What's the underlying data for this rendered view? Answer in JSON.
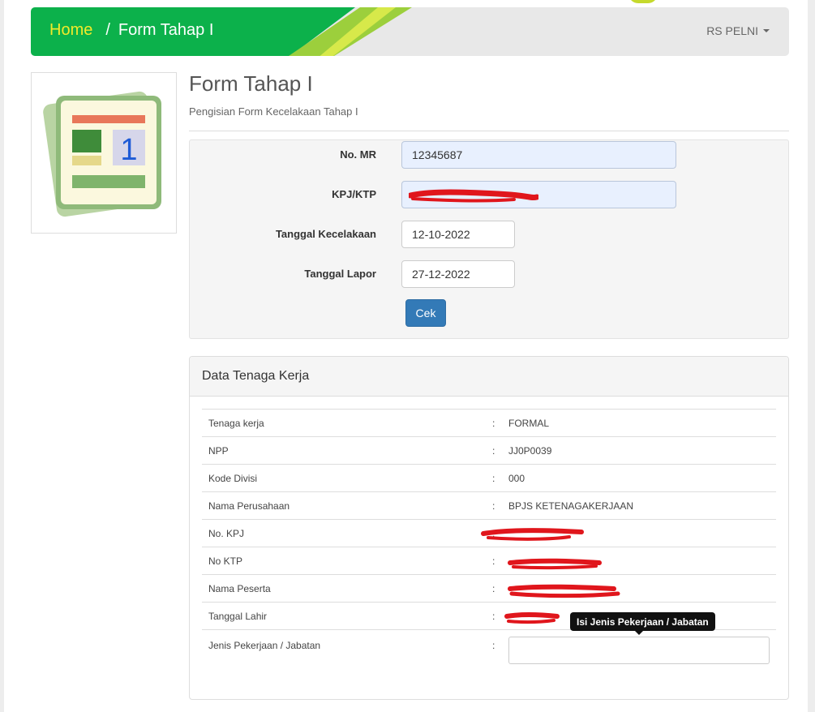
{
  "navbar": {
    "home_label": "Home",
    "separator": "/",
    "current_label": "Form Tahap I",
    "user_label": "RS PELNI"
  },
  "header": {
    "title": "Form Tahap I",
    "subtitle": "Pengisian Form Kecelakaan Tahap I"
  },
  "form": {
    "no_mr": {
      "label": "No. MR",
      "value": "12345687"
    },
    "kpj_ktp": {
      "label": "KPJ/KTP",
      "value": ""
    },
    "tanggal_kecelakaan": {
      "label": "Tanggal Kecelakaan",
      "value": "12-10-2022"
    },
    "tanggal_lapor": {
      "label": "Tanggal Lapor",
      "value": "27-12-2022"
    },
    "submit_label": "Cek"
  },
  "panel": {
    "title": "Data Tenaga Kerja",
    "colon": ":",
    "rows": [
      {
        "label": "Tenaga kerja",
        "value": "FORMAL"
      },
      {
        "label": "NPP",
        "value": "JJ0P0039"
      },
      {
        "label": "Kode Divisi",
        "value": "000"
      },
      {
        "label": "Nama Perusahaan",
        "value": "BPJS KETENAGAKERJAAN"
      },
      {
        "label": "No. KPJ",
        "value": ""
      },
      {
        "label": "No KTP",
        "value": ""
      },
      {
        "label": "Nama Peserta",
        "value": ""
      },
      {
        "label": "Tanggal Lahir",
        "value": ""
      },
      {
        "label": "Jenis Pekerjaan / Jabatan",
        "value": ""
      }
    ]
  },
  "tooltip": {
    "text": "Isi Jenis Pekerjaan / Jabatan"
  },
  "colors": {
    "nav_green": "#0cb14b",
    "home_yellow": "#f2ea2a",
    "button_blue": "#337ab7",
    "redaction_red": "#e0161c"
  }
}
